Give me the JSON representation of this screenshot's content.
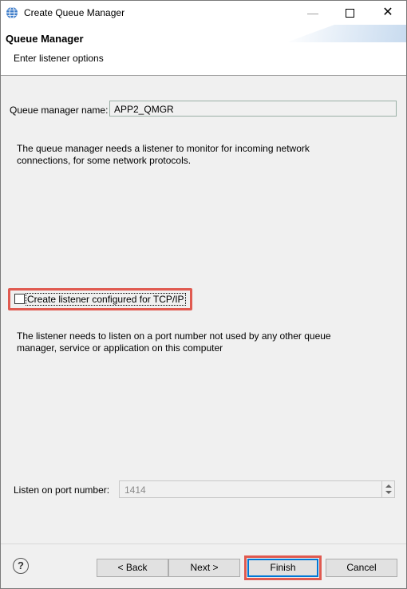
{
  "window": {
    "title": "Create Queue Manager",
    "minimize": "—",
    "close": "✕"
  },
  "banner": {
    "title": "Queue Manager",
    "subtitle": "Enter listener options"
  },
  "form": {
    "qm_name_label": "Queue manager name:",
    "qm_name_value": "APP2_QMGR",
    "description1": "The queue manager needs a listener to monitor for incoming network connections, for some network protocols.",
    "listener_checkbox_label": "Create listener configured for TCP/IP",
    "listener_checked": false,
    "description2": "The listener needs to listen on a port number not used by any other queue manager, service or application on this computer",
    "port_label": "Listen on port number:",
    "port_value": "1414"
  },
  "footer": {
    "help": "?",
    "back_label": "< Back",
    "next_label": "Next >",
    "finish_label": "Finish",
    "cancel_label": "Cancel"
  },
  "colors": {
    "highlight": "#e05a50",
    "focus": "#0078d7"
  }
}
